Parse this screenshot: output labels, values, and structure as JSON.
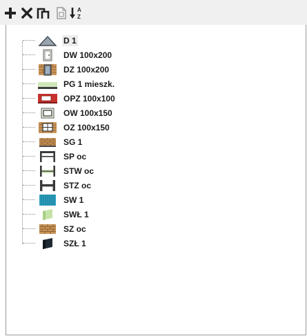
{
  "toolbar": {
    "buttons": [
      {
        "name": "add-button",
        "icon": "plus-icon"
      },
      {
        "name": "delete-button",
        "icon": "close-icon"
      },
      {
        "name": "copy-button",
        "icon": "copy-icon"
      },
      {
        "name": "document-button",
        "icon": "document-icon"
      },
      {
        "name": "sort-button",
        "icon": "sort-az-icon"
      }
    ]
  },
  "tree": {
    "items": [
      {
        "label": "D 1",
        "icon": "roof-triangle-icon",
        "selected": true
      },
      {
        "label": "DW 100x200",
        "icon": "door-interior-icon"
      },
      {
        "label": "DZ 100x200",
        "icon": "door-exterior-icon"
      },
      {
        "label": "PG 1 mieszk.",
        "icon": "floor-slab-icon"
      },
      {
        "label": "OPZ 100x100",
        "icon": "window-red-icon"
      },
      {
        "label": "OW 100x150",
        "icon": "window-interior-icon"
      },
      {
        "label": "OZ 100x150",
        "icon": "window-exterior-icon"
      },
      {
        "label": "SG 1",
        "icon": "brick-wall-icon"
      },
      {
        "label": "SP oc",
        "icon": "frame-ceiling-icon"
      },
      {
        "label": "STW oc",
        "icon": "frame-interior-icon"
      },
      {
        "label": "STZ oc",
        "icon": "frame-exterior-icon"
      },
      {
        "label": "SW 1",
        "icon": "wall-blue-icon"
      },
      {
        "label": "SWŁ 1",
        "icon": "wall-green-icon"
      },
      {
        "label": "SZ oc",
        "icon": "brick-exterior-icon"
      },
      {
        "label": "SZŁ 1",
        "icon": "wall-dark-icon"
      }
    ]
  }
}
